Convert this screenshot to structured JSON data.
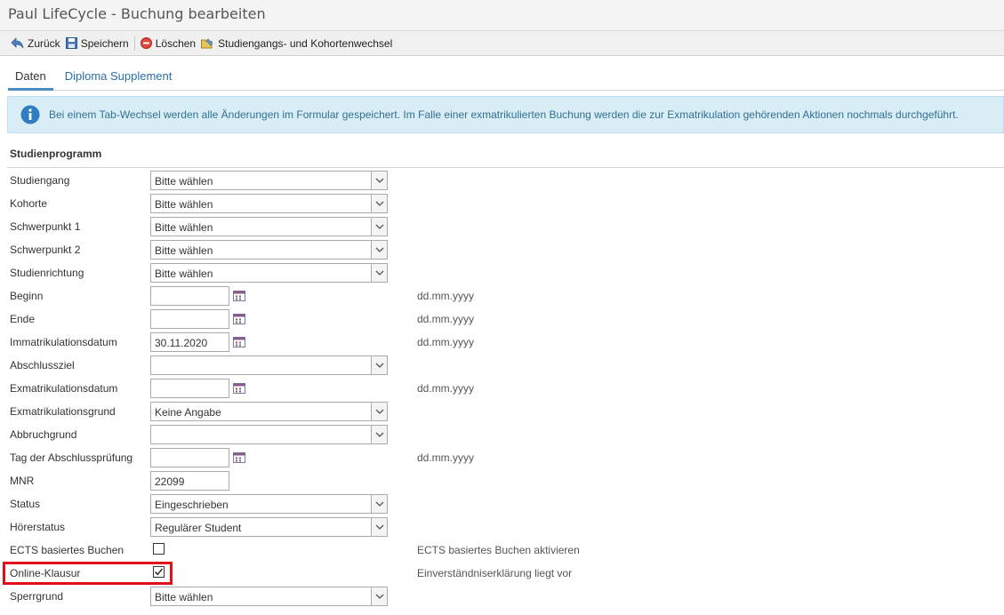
{
  "window": {
    "title": "Paul LifeCycle - Buchung bearbeiten"
  },
  "toolbar": {
    "back_label": "Zurück",
    "save_label": "Speichern",
    "delete_label": "Löschen",
    "change_label": "Studiengangs- und Kohortenwechsel"
  },
  "tabs": [
    {
      "label": "Daten",
      "active": true
    },
    {
      "label": "Diploma Supplement",
      "active": false
    }
  ],
  "info": {
    "text": "Bei einem Tab-Wechsel werden alle Änderungen im Formular gespeichert. Im Falle einer exmatrikulierten Buchung werden die zur Exmatrikulation gehörenden Aktionen nochmals durchgeführt."
  },
  "section": {
    "title": "Studienprogramm"
  },
  "form": {
    "studiengang": {
      "label": "Studiengang",
      "value": "Bitte wählen"
    },
    "kohorte": {
      "label": "Kohorte",
      "value": "Bitte wählen"
    },
    "schwerpunkt1": {
      "label": "Schwerpunkt 1",
      "value": "Bitte wählen"
    },
    "schwerpunkt2": {
      "label": "Schwerpunkt 2",
      "value": "Bitte wählen"
    },
    "studienrichtung": {
      "label": "Studienrichtung",
      "value": "Bitte wählen"
    },
    "beginn": {
      "label": "Beginn",
      "value": "",
      "hint": "dd.mm.yyyy"
    },
    "ende": {
      "label": "Ende",
      "value": "",
      "hint": "dd.mm.yyyy"
    },
    "immatrikulationsdatum": {
      "label": "Immatrikulationsdatum",
      "value": "30.11.2020",
      "hint": "dd.mm.yyyy"
    },
    "abschlussziel": {
      "label": "Abschlussziel",
      "value": ""
    },
    "exmatrikulationsdatum": {
      "label": "Exmatrikulationsdatum",
      "value": "",
      "hint": "dd.mm.yyyy"
    },
    "exmatrikulationsgrund": {
      "label": "Exmatrikulationsgrund",
      "value": "Keine Angabe"
    },
    "abbruchgrund": {
      "label": "Abbruchgrund",
      "value": ""
    },
    "abschlusspruefung": {
      "label": "Tag der Abschlussprüfung",
      "value": "",
      "hint": "dd.mm.yyyy"
    },
    "mnr": {
      "label": "MNR",
      "value": "22099"
    },
    "status": {
      "label": "Status",
      "value": "Eingeschrieben"
    },
    "hoererstatus": {
      "label": "Hörerstatus",
      "value": "Regulärer Student"
    },
    "ects": {
      "label": "ECTS basiertes Buchen",
      "checked": false,
      "hint": "ECTS basiertes Buchen aktivieren"
    },
    "online_klausur": {
      "label": "Online-Klausur",
      "checked": true,
      "hint": "Einverständniserklärung liegt vor"
    },
    "sperrgrund": {
      "label": "Sperrgrund",
      "value": "Bitte wählen"
    }
  },
  "colors": {
    "accent": "#4a8bc2",
    "info_bg": "#d9edf7",
    "highlight": "#e0101b"
  }
}
